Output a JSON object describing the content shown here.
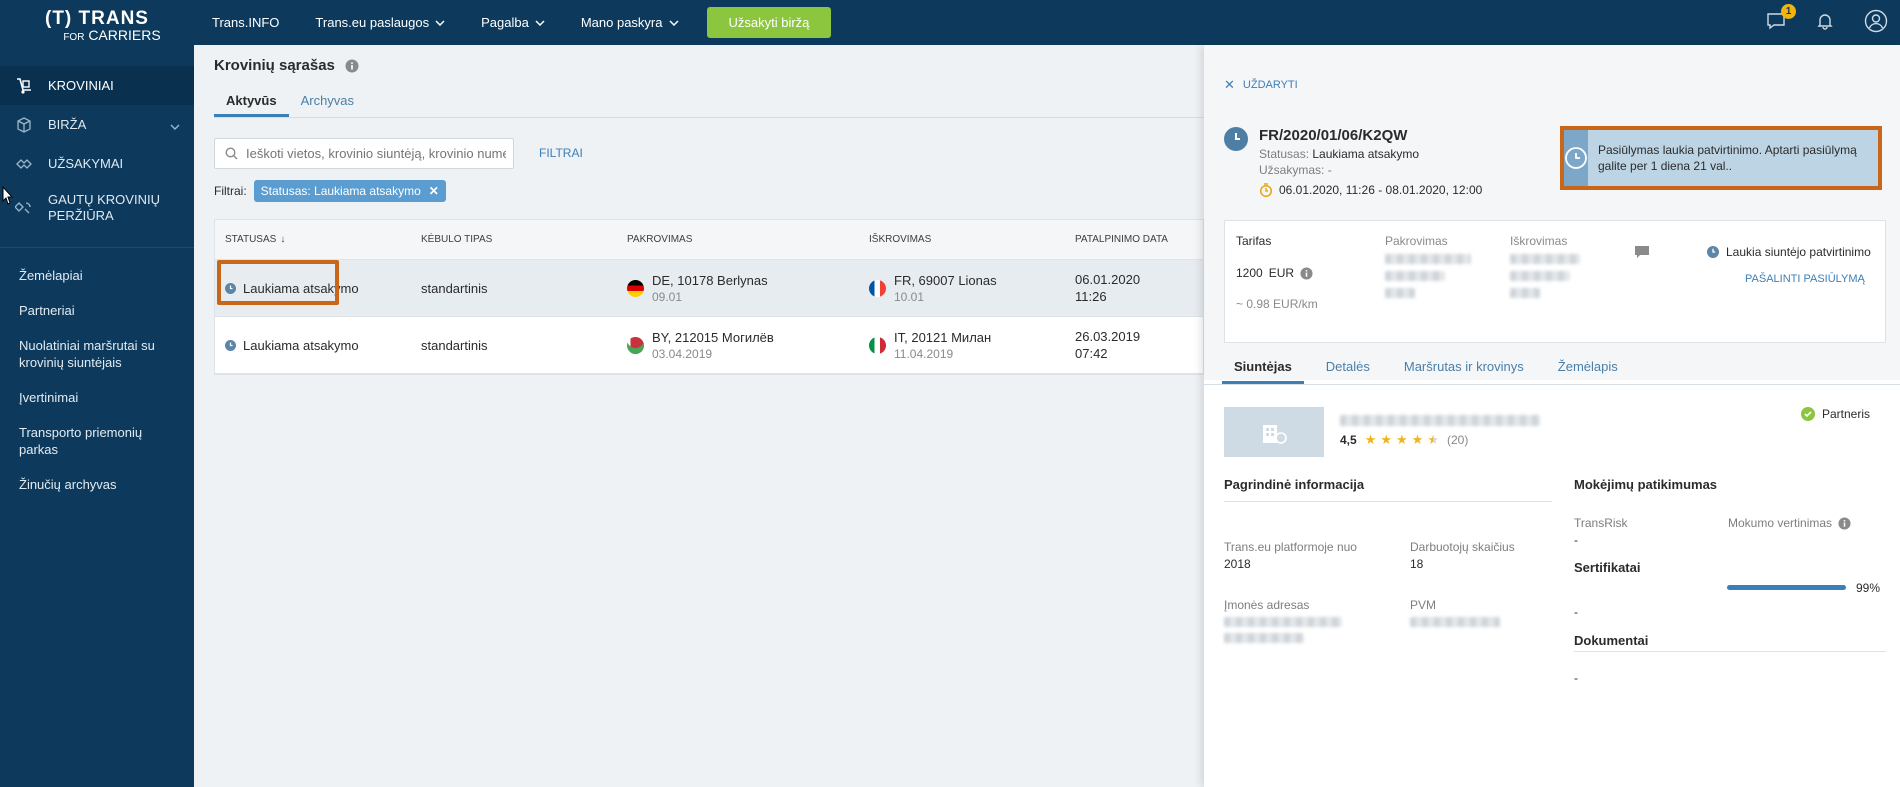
{
  "brand": {
    "line1": "(T) TRANS",
    "for": "FOR",
    "carriers": "CARRIERS"
  },
  "sidebar": {
    "main": [
      {
        "label": "KROVINIAI"
      },
      {
        "label": "BIRŽA"
      },
      {
        "label": "UŽSAKYMAI"
      },
      {
        "label": "GAUTŲ KROVINIŲ PERŽIŪRA"
      }
    ],
    "secondary": [
      "Žemėlapiai",
      "Partneriai",
      "Nuolatiniai maršrutai su krovinių siuntėjais",
      "Įvertinimai",
      "Transporto priemonių parkas",
      "Žinučių archyvas"
    ]
  },
  "topbar": {
    "links": [
      "Trans.INFO",
      "Trans.eu paslaugos",
      "Pagalba",
      "Mano paskyra"
    ],
    "cta": "Užsakyti biržą",
    "message_count": "1"
  },
  "page": {
    "title": "Krovinių sąrašas",
    "tabs": [
      "Aktyvūs",
      "Archyvas"
    ],
    "search_placeholder": "Ieškoti vietos, krovinio siuntėją, krovinio nume...",
    "filters_link": "FILTRAI",
    "filters_label": "Filtrai:",
    "active_filter": "Statusas: Laukiama atsakymo"
  },
  "table": {
    "headers": [
      "STATUSAS",
      "KĖBULO TIPAS",
      "PAKROVIMAS",
      "IŠKROVIMAS",
      "PATALPINIMO DATA"
    ],
    "sort_indicator": "↓",
    "rows": [
      {
        "status": "Laukiama atsakymo",
        "body": "standartinis",
        "load": "DE, 10178 Berlynas",
        "load_date": "09.01",
        "unload": "FR, 69007 Lionas",
        "unload_date": "10.01",
        "posted": "06.01.2020",
        "posted_time": "11:26"
      },
      {
        "status": "Laukiama atsakymo",
        "body": "standartinis",
        "load": "BY, 212015 Могилёв",
        "load_date": "03.04.2019",
        "unload": "IT, 20121 Милан",
        "unload_date": "11.04.2019",
        "posted": "26.03.2019",
        "posted_time": "07:42"
      }
    ]
  },
  "panel": {
    "close": "UŽDARYTI",
    "ref": "FR/2020/01/06/K2QW",
    "status_label": "Statusas:",
    "status_value": "Laukiama atsakymo",
    "order_label": "Užsakymas:",
    "order_value": "-",
    "dates": "06.01.2020, 11:26 - 08.01.2020, 12:00",
    "notice": "Pasiūlymas laukia patvirtinimo. Aptarti pasiūlymą galite per 1 diena 21 val..",
    "tariff_label": "Tarifas",
    "tariff_value": "1200",
    "tariff_currency": "EUR",
    "per_km": "~ 0.98 EUR/km",
    "load_label": "Pakrovimas",
    "unload_label": "Iškrovimas",
    "sender_status": "Laukia siuntėjo patvirtinimo",
    "remove": "PAŠALINTI PASIŪLYMĄ",
    "tabs": [
      "Siuntėjas",
      "Detalės",
      "Maršrutas ir krovinys",
      "Žemėlapis"
    ],
    "rating": "4,5",
    "rating_count": "(20)",
    "partner": "Partneris",
    "basic_info_title": "Pagrindinė informacija",
    "since_label": "Trans.eu platformoje nuo",
    "since_value": "2018",
    "employees_label": "Darbuotojų skaičius",
    "employees_value": "18",
    "address_label": "Įmonės adresas",
    "vat_label": "PVM",
    "payment_title": "Mokėjimų patikimumas",
    "transrisk_label": "TransRisk",
    "transrisk_value": "-",
    "payment_rating_label": "Mokumo vertinimas",
    "payment_rating_value": "99%",
    "payment_rating_fraction": 0.99,
    "certs_title": "Sertifikatai",
    "certs_value": "-",
    "docs_title": "Dokumentai",
    "docs_value": "-"
  },
  "colors": {
    "sidebar": "#0d3a5c",
    "accent": "#3b7fb7",
    "cta": "#8cc63f",
    "highlight": "#c8661a"
  }
}
